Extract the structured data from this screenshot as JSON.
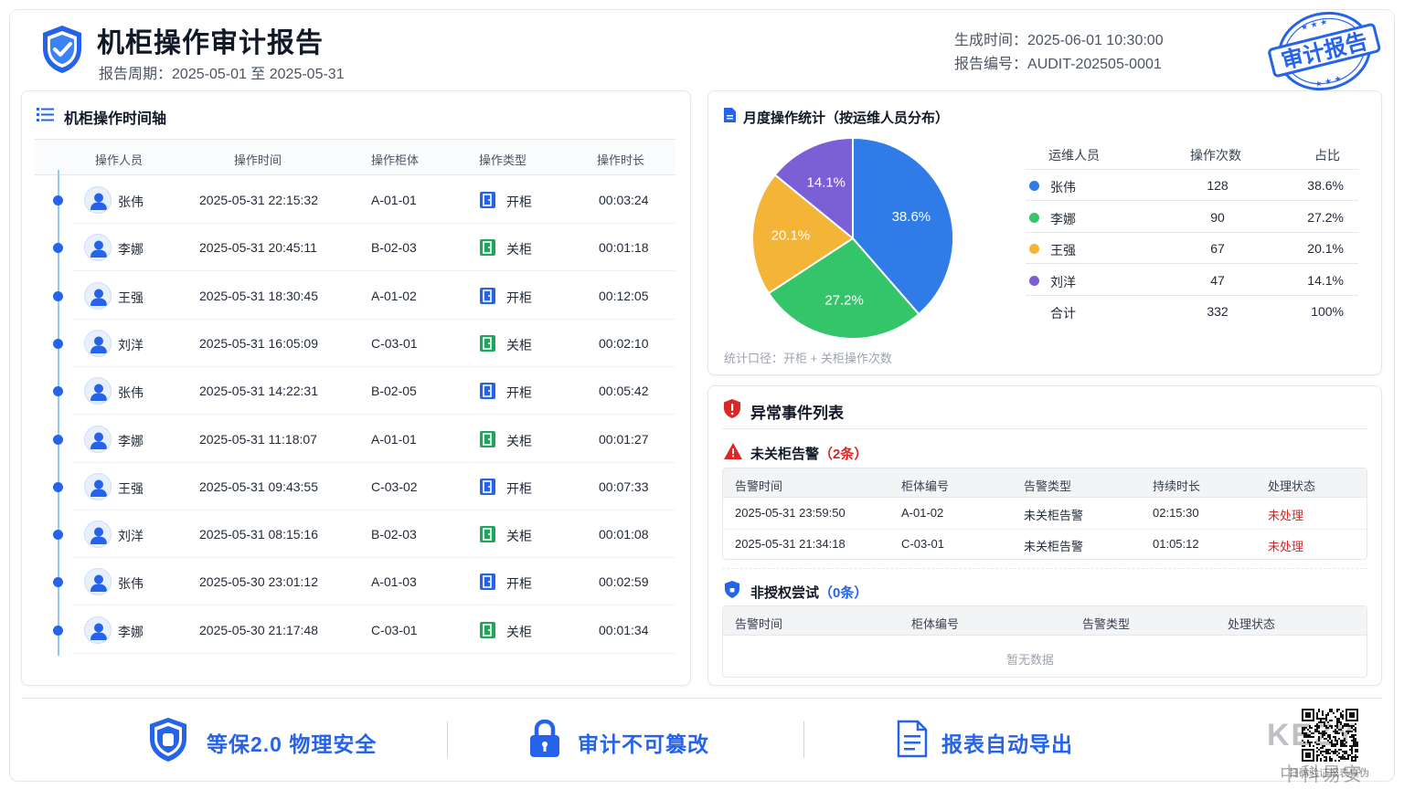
{
  "header": {
    "title": "机柜操作审计报告",
    "period_label": "报告周期：",
    "period_value": "2025-05-01 至 2025-05-31",
    "generated_label": "生成时间：",
    "generated_value": "2025-06-01 10:30:00",
    "report_no_label": "报告编号：",
    "report_no_value": "AUDIT-202505-0001",
    "stamp_text": "审计报告"
  },
  "timeline": {
    "title": "机柜操作时间轴",
    "columns": [
      "操作人员",
      "操作时间",
      "操作柜体",
      "操作类型",
      "操作时长"
    ],
    "rows": [
      {
        "person": "张伟",
        "time": "2025-05-31 22:15:32",
        "cabinet": "A-01-01",
        "type": "开柜",
        "kind": "open",
        "duration": "00:03:24"
      },
      {
        "person": "李娜",
        "time": "2025-05-31 20:45:11",
        "cabinet": "B-02-03",
        "type": "关柜",
        "kind": "close",
        "duration": "00:01:18"
      },
      {
        "person": "王强",
        "time": "2025-05-31 18:30:45",
        "cabinet": "A-01-02",
        "type": "开柜",
        "kind": "open",
        "duration": "00:12:05"
      },
      {
        "person": "刘洋",
        "time": "2025-05-31 16:05:09",
        "cabinet": "C-03-01",
        "type": "关柜",
        "kind": "close",
        "duration": "00:02:10"
      },
      {
        "person": "张伟",
        "time": "2025-05-31 14:22:31",
        "cabinet": "B-02-05",
        "type": "开柜",
        "kind": "open",
        "duration": "00:05:42"
      },
      {
        "person": "李娜",
        "time": "2025-05-31 11:18:07",
        "cabinet": "A-01-01",
        "type": "关柜",
        "kind": "close",
        "duration": "00:01:27"
      },
      {
        "person": "王强",
        "time": "2025-05-31 09:43:55",
        "cabinet": "C-03-02",
        "type": "开柜",
        "kind": "open",
        "duration": "00:07:33"
      },
      {
        "person": "刘洋",
        "time": "2025-05-31 08:15:16",
        "cabinet": "B-02-03",
        "type": "关柜",
        "kind": "close",
        "duration": "00:01:08"
      },
      {
        "person": "张伟",
        "time": "2025-05-30 23:01:12",
        "cabinet": "A-01-03",
        "type": "开柜",
        "kind": "open",
        "duration": "00:02:59"
      },
      {
        "person": "李娜",
        "time": "2025-05-30 21:17:48",
        "cabinet": "C-03-01",
        "type": "关柜",
        "kind": "close",
        "duration": "00:01:34"
      }
    ]
  },
  "stats": {
    "title": "月度操作统计（按运维人员分布）",
    "columns": [
      "运维人员",
      "操作次数",
      "占比"
    ],
    "rows": [
      {
        "name": "张伟",
        "count": "128",
        "pct": "38.6%",
        "color": "#2f7be8"
      },
      {
        "name": "李娜",
        "count": "90",
        "pct": "27.2%",
        "color": "#34c46a"
      },
      {
        "name": "王强",
        "count": "67",
        "pct": "20.1%",
        "color": "#f3b437"
      },
      {
        "name": "刘洋",
        "count": "47",
        "pct": "14.1%",
        "color": "#7b5fd6"
      }
    ],
    "total": {
      "name": "合计",
      "count": "332",
      "pct": "100%"
    },
    "note": "统计口径：开柜 + 关柜操作次数"
  },
  "chart_data": {
    "type": "pie",
    "categories": [
      "张伟",
      "李娜",
      "王强",
      "刘洋"
    ],
    "values": [
      38.6,
      27.2,
      20.1,
      14.1
    ],
    "labels": [
      "38.6%",
      "27.2%",
      "20.1%",
      "14.1%"
    ],
    "colors": [
      "#2f7be8",
      "#34c46a",
      "#f3b437",
      "#7b5fd6"
    ]
  },
  "anomaly": {
    "title": "异常事件列表",
    "unclosed": {
      "title": "未关柜告警",
      "count": "（2条）",
      "columns": [
        "告警时间",
        "柜体编号",
        "告警类型",
        "持续时长",
        "处理状态"
      ],
      "rows": [
        {
          "time": "2025-05-31 23:59:50",
          "cabinet": "A-01-02",
          "type": "未关柜告警",
          "duration": "02:15:30",
          "status": "未处理"
        },
        {
          "time": "2025-05-31 21:34:18",
          "cabinet": "C-03-01",
          "type": "未关柜告警",
          "duration": "01:05:12",
          "status": "未处理"
        }
      ]
    },
    "unauthorized": {
      "title": "非授权尝试",
      "count": "（0条）",
      "columns": [
        "告警时间",
        "柜体编号",
        "告警类型",
        "处理状态"
      ],
      "empty": "暂无数据"
    }
  },
  "footer": {
    "item1": "等保2.0 物理安全",
    "item2": "审计不可篡改",
    "item3": "报表自动导出",
    "watermark_top": "KEZY",
    "watermark_bottom": "中科易安",
    "qr_caption": "扫码验证报表真伪"
  }
}
